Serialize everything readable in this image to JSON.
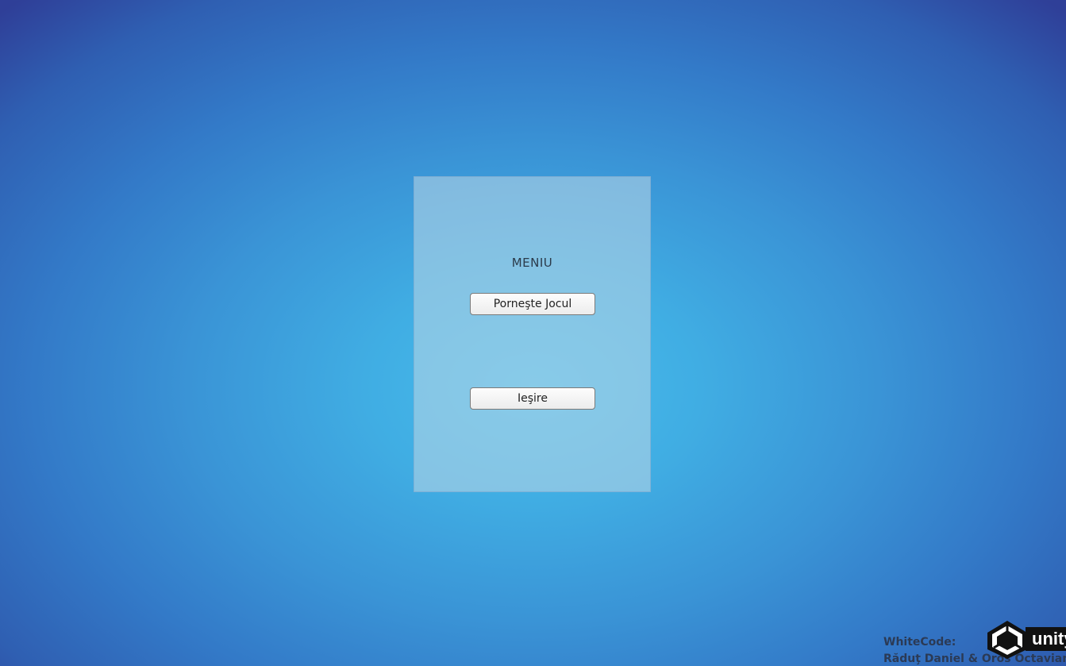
{
  "menu": {
    "title": "MENIU",
    "start_label": "Porneşte Jocul",
    "exit_label": "Ieşire"
  },
  "credits": {
    "line1": "WhiteCode:",
    "line2": "Răduţ Daniel & Oros Octavian"
  },
  "logo": {
    "icon": "unity-icon",
    "word": "unity"
  },
  "colors": {
    "background_center": "#47bcec",
    "background_edge": "#2f3f98",
    "panel": "#8fc6e2",
    "button": "#f4f4f4",
    "credits_text": "#2b3a55"
  }
}
